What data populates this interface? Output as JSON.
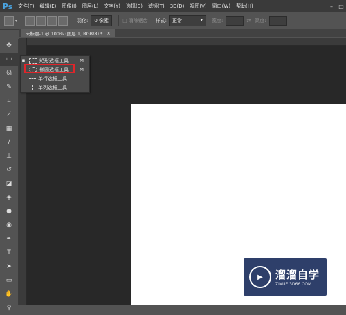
{
  "menubar": {
    "logo": "Ps",
    "items": [
      "文件(F)",
      "编辑(E)",
      "图像(I)",
      "图层(L)",
      "文字(Y)",
      "选择(S)",
      "滤镜(T)",
      "3D(D)",
      "视图(V)",
      "窗口(W)",
      "帮助(H)"
    ]
  },
  "options": {
    "feather_label": "羽化:",
    "feather_value": "0 像素",
    "antialias_label": "消除锯齿",
    "style_label": "样式:",
    "style_value": "正常",
    "width_label": "宽度:",
    "height_label": "高度:"
  },
  "document_tab": {
    "title": "未标题-1 @ 100% (图层 1, RGB/8) *",
    "close": "×"
  },
  "flyout": {
    "items": [
      {
        "label": "矩形选框工具",
        "key": "M",
        "icon": "rect-marquee-icon",
        "selected": true
      },
      {
        "label": "椭圆选框工具",
        "key": "M",
        "icon": "ellipse-marquee-icon",
        "selected": false
      },
      {
        "label": "单行选框工具",
        "key": "",
        "icon": "single-row-marquee-icon",
        "selected": false
      },
      {
        "label": "单列选框工具",
        "key": "",
        "icon": "single-column-marquee-icon",
        "selected": false
      }
    ]
  },
  "watermark": {
    "title": "溜溜自学",
    "url": "ZIXUE.3D66.COM"
  },
  "colors": {
    "highlight": "#e0252a",
    "ps_logo": "#4aa3df",
    "watermark_bg": "#2e3f6a"
  }
}
